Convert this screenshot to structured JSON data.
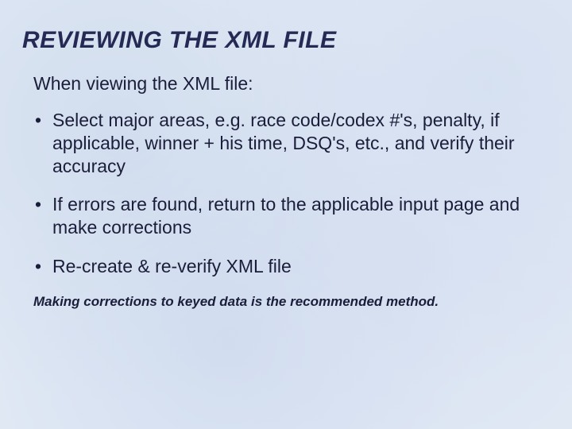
{
  "slide": {
    "title": "REVIEWING THE XML FILE",
    "intro": "When viewing the XML file:",
    "bullets": [
      "Select major areas, e.g. race code/codex #'s, penalty, if applicable, winner + his time, DSQ's, etc., and verify their accuracy",
      "If errors are found, return to the applicable input page and make corrections",
      "Re-create & re-verify XML file"
    ],
    "note": "Making corrections to keyed data is the recommended method."
  }
}
